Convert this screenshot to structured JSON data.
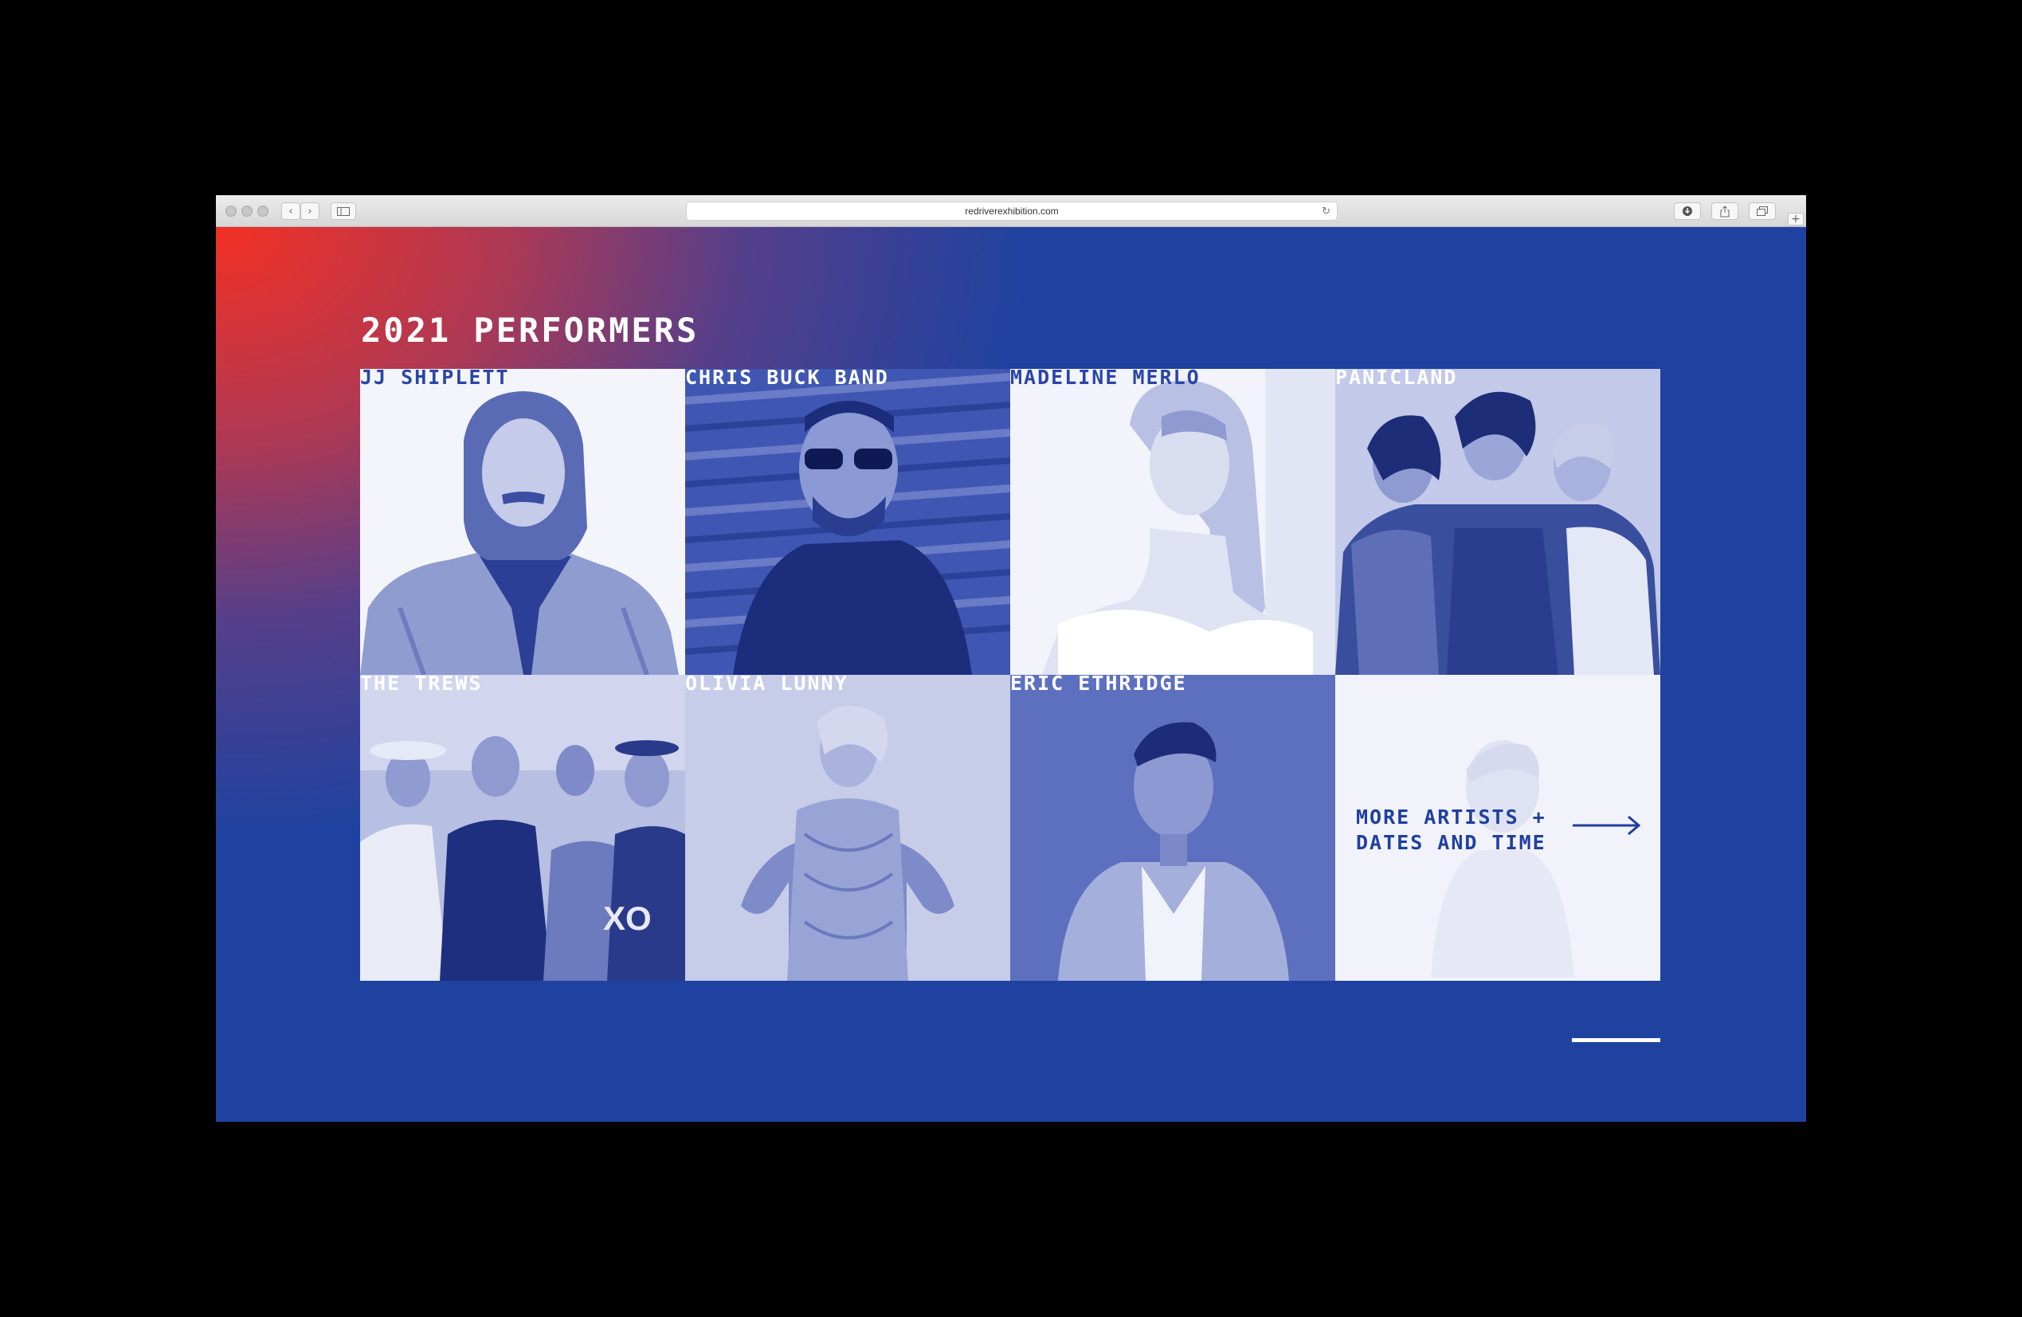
{
  "browser": {
    "url": "redriverexhibition.com"
  },
  "page": {
    "heading": "2021 PERFORMERS",
    "performers": [
      {
        "name": "JJ SHIPLETT"
      },
      {
        "name": "CHRIS BUCK BAND"
      },
      {
        "name": "MADELINE MERLO"
      },
      {
        "name": "PANICLAND"
      },
      {
        "name": "THE TREWS"
      },
      {
        "name": "OLIVIA LUNNY"
      },
      {
        "name": "ERIC ETHRIDGE"
      }
    ],
    "more_link": {
      "line1": "MORE ARTISTS +",
      "line2": "DATES AND TIME"
    }
  },
  "colors": {
    "brand_blue": "#1f42a0",
    "gradient_red": "#f33024",
    "text_white": "#ffffff"
  }
}
